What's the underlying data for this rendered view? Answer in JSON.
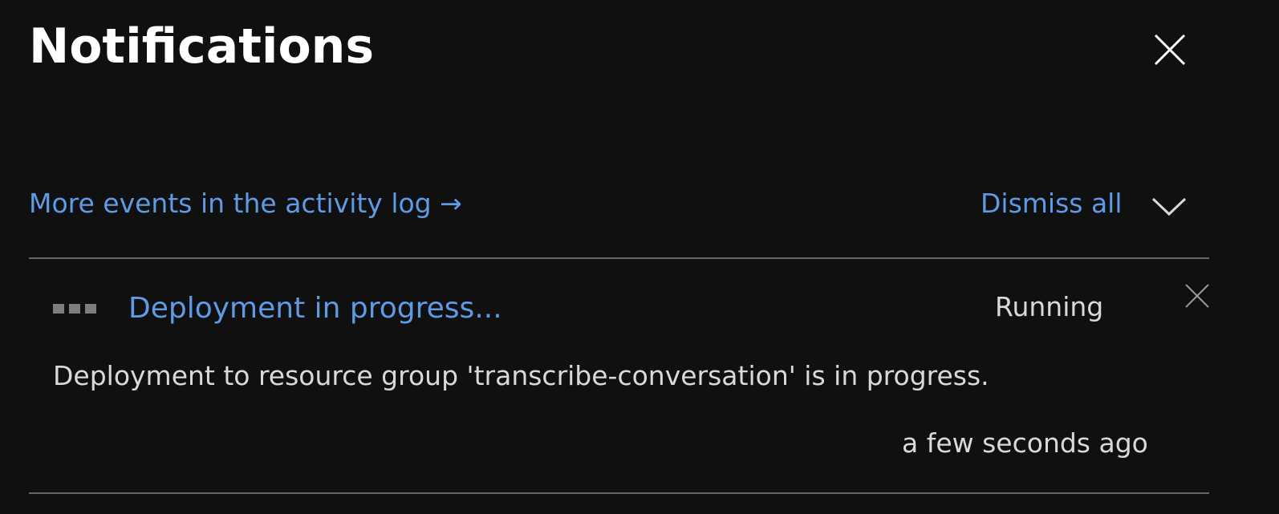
{
  "panel": {
    "title": "Notifications",
    "close_icon": "close-icon"
  },
  "actions": {
    "activity_log_link": "More events in the activity log →",
    "dismiss_all": "Dismiss all",
    "collapse_icon": "chevron-down-icon"
  },
  "notifications": [
    {
      "status_icon": "progress-dots-icon",
      "title": "Deployment in progress...",
      "status": "Running",
      "message": "Deployment to resource group 'transcribe-conversation' is in progress.",
      "time": "a few seconds ago",
      "close_icon": "close-icon"
    }
  ],
  "colors": {
    "background": "#101010",
    "link": "#5f9ae4",
    "text": "#d9d9d9",
    "title": "#ffffff",
    "divider": "#666666"
  }
}
